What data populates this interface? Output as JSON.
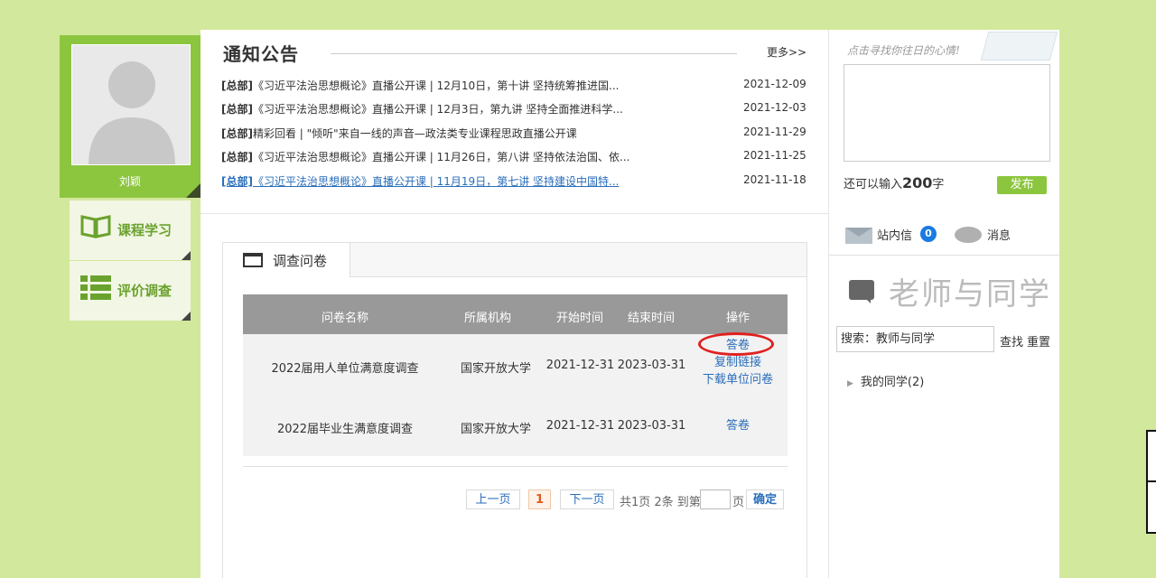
{
  "user": {
    "name": "刘颖"
  },
  "sidebar": {
    "items": [
      {
        "label": "课程学习",
        "icon": "book-icon"
      },
      {
        "label": "评价调查",
        "icon": "list-icon"
      }
    ]
  },
  "notices": {
    "title": "通知公告",
    "more": "更多>>",
    "items": [
      {
        "category": "[总部]",
        "text": "《习近平法治思想概论》直播公开课 | 12月10日，第十讲 坚持统筹推进国...",
        "date": "2021-12-09"
      },
      {
        "category": "[总部]",
        "text": "《习近平法治思想概论》直播公开课 | 12月3日，第九讲 坚持全面推进科学...",
        "date": "2021-12-03"
      },
      {
        "category": "[总部]",
        "text": "精彩回看 | \"倾听\"来自一线的声音—政法类专业课程思政直播公开课",
        "date": "2021-11-29"
      },
      {
        "category": "[总部]",
        "text": "《习近平法治思想概论》直播公开课 | 11月26日，第八讲 坚持依法治国、依...",
        "date": "2021-11-25"
      },
      {
        "category": "[总部]",
        "text": "《习近平法治思想概论》直播公开课 | 11月19日，第七讲 坚持建设中国特...",
        "date": "2021-11-18"
      }
    ]
  },
  "mood": {
    "hint": "点击寻找你往日的心情!",
    "remain_prefix": "还可以输入",
    "remain_count": "200",
    "remain_suffix": "字",
    "publish": "发布"
  },
  "survey": {
    "tab_label": "调查问卷",
    "columns": [
      "问卷名称",
      "所属机构",
      "开始时间",
      "结束时间",
      "操作"
    ],
    "rows": [
      {
        "name": "2022届用人单位满意度调查",
        "org": "国家开放大学",
        "start": "2021-12-31",
        "end": "2023-03-31",
        "actions": [
          "答卷",
          "复制链接",
          "下载单位问卷"
        ]
      },
      {
        "name": "2022届毕业生满意度调查",
        "org": "国家开放大学",
        "start": "2021-12-31",
        "end": "2023-03-31",
        "actions": [
          "答卷"
        ]
      }
    ],
    "pagination": {
      "prev": "上一页",
      "current": "1",
      "next": "下一页",
      "info": "共1页 2条 到第",
      "unit": "页",
      "ok": "确定"
    }
  },
  "right_panel": {
    "inbox_label": "站内信",
    "inbox_count": "0",
    "news_label": "消息",
    "title": "老师与同学",
    "search_value": "搜索：教师与同学",
    "search_btn": "查找",
    "reset_btn": "重置",
    "classmates": "我的同学(2)"
  },
  "colors": {
    "background": "#d2e89d",
    "accent_green": "#8cc63f",
    "link_blue": "#2a6ebb",
    "highlight_red": "#e02020"
  }
}
